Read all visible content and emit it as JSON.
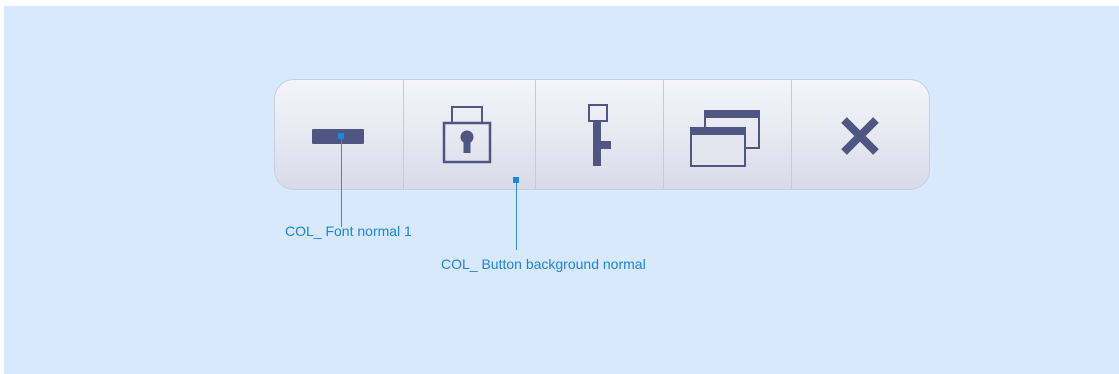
{
  "colors": {
    "icon_fill": "#4f5682",
    "annotation_text": "#1b86d9",
    "toolbar_border": "#c9cfe0",
    "background": "#d8e8fd"
  },
  "toolbar": {
    "buttons": [
      {
        "icon": "minimize-icon"
      },
      {
        "icon": "lock-icon"
      },
      {
        "icon": "key-icon"
      },
      {
        "icon": "restore-windows-icon"
      },
      {
        "icon": "close-icon"
      }
    ]
  },
  "annotations": {
    "font_color_label": "COL_ Font  normal 1",
    "button_bg_label": "COL_ Button background normal"
  }
}
